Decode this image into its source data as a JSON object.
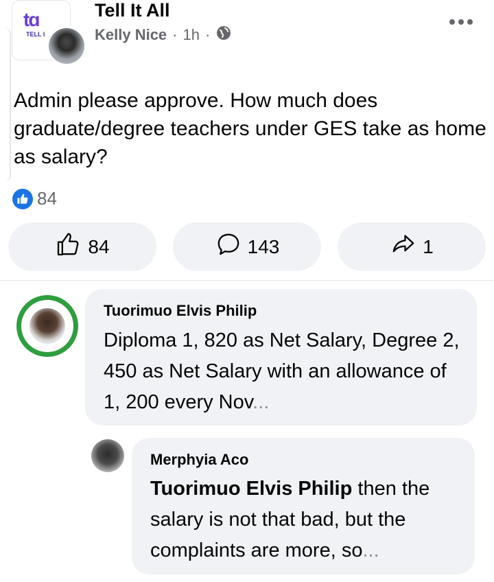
{
  "post": {
    "group_name": "Tell It All",
    "group_logo_text": "TELL I",
    "author": "Kelly Nice",
    "separator": "·",
    "time": "1h",
    "text": "Admin please approve. How much does graduate/degree teachers under GES take as home as salary?",
    "reaction_count": "84",
    "actions": {
      "like_count": "84",
      "comment_count": "143",
      "share_count": "1"
    }
  },
  "comments": [
    {
      "name": "Tuorimuo Elvis Philip",
      "text": "Diploma 1, 820 as Net Salary, Degree 2, 450 as Net Salary with an allowance of 1, 200 every Nov",
      "ellipsis": "..."
    },
    {
      "name": "Merphyia Aco",
      "mention": "Tuorimuo Elvis Philip",
      "text": " then the salary is not that bad, but the complaints are more, so",
      "ellipsis": "..."
    }
  ],
  "colors": {
    "accent": "#1b74e4",
    "bubble": "#f0f2f5",
    "muted": "#65676b",
    "badge_green": "#2e9e3e"
  },
  "icons": [
    "more-options-icon",
    "globe-icon",
    "like-reaction-icon",
    "thumbs-up-icon",
    "comment-icon",
    "share-icon"
  ]
}
